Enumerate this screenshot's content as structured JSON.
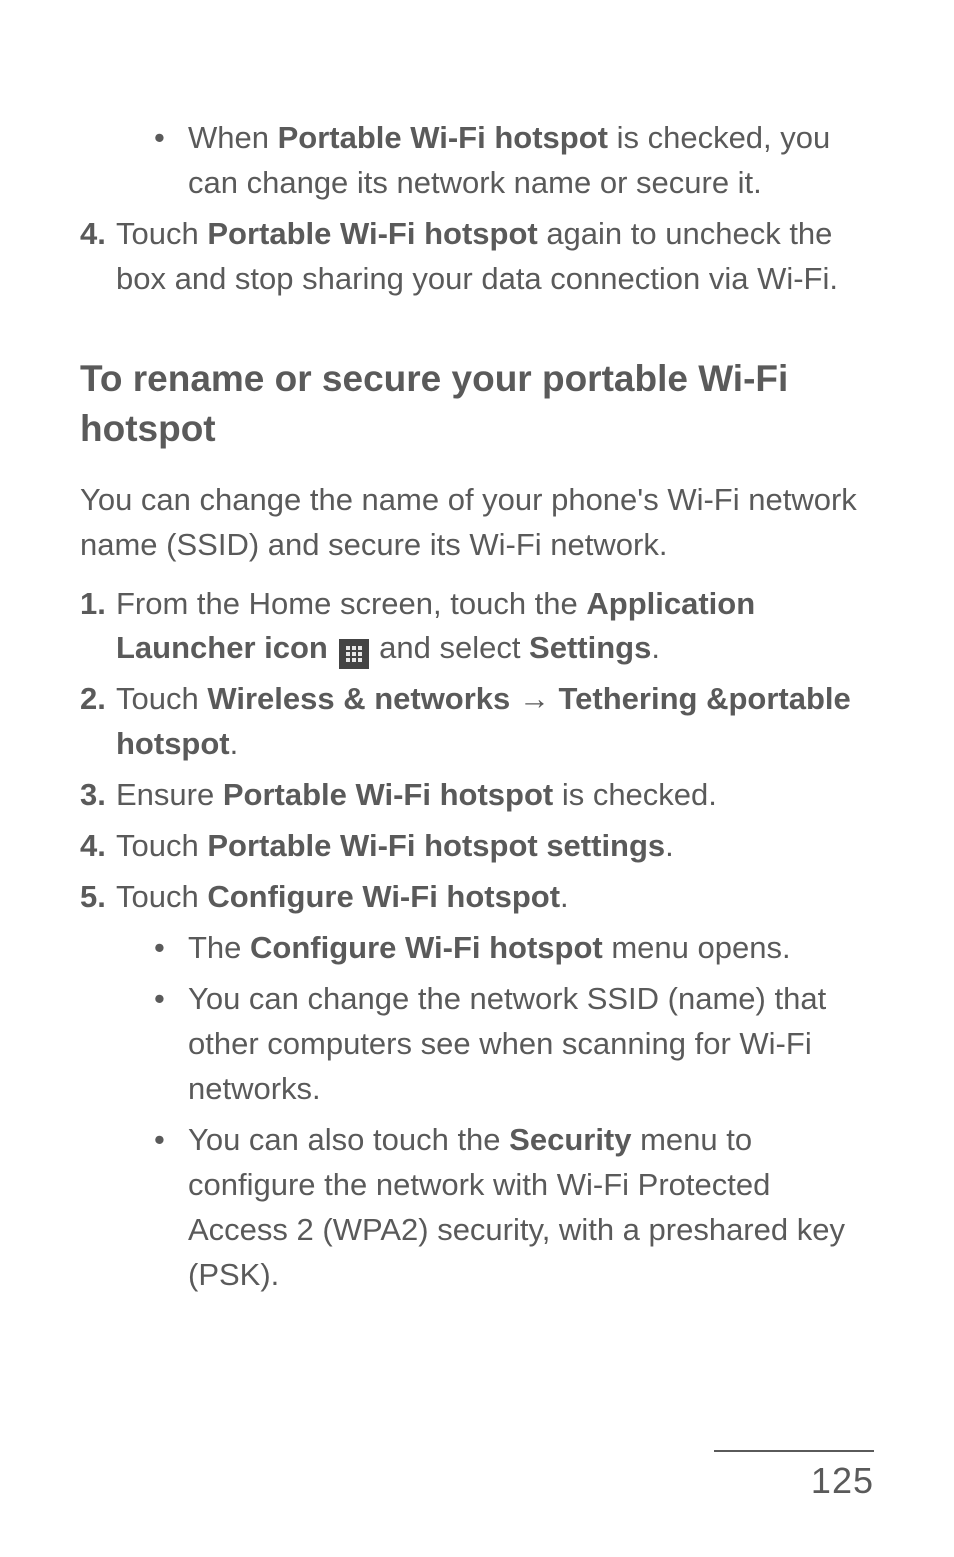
{
  "section1": {
    "bullet1_pre": "When ",
    "bullet1_bold": "Portable Wi-Fi hotspot",
    "bullet1_post": " is checked, you can change its network name or secure it.",
    "step4_num": "4.",
    "step4_pre": "Touch ",
    "step4_bold": "Portable Wi-Fi hotspot",
    "step4_post": " again to uncheck the box and stop sharing your data connection via Wi-Fi."
  },
  "heading2": "To rename or secure your portable Wi-Fi hotspot",
  "intro2": "You can change the name of your phone's Wi-Fi network name (SSID) and secure its Wi-Fi network.",
  "steps2": {
    "s1_num": "1.",
    "s1_pre": " From the Home screen, touch the ",
    "s1_bold1": "Application Launcher icon",
    "s1_mid": " ",
    "s1_post1": " and select ",
    "s1_bold2": "Settings",
    "s1_end": ".",
    "s2_num": "2.",
    "s2_pre": "Touch ",
    "s2_bold1": "Wireless & networks",
    "s2_arrow": " → ",
    "s2_bold2": "Tethering &portable hotspot",
    "s2_end": ".",
    "s3_num": "3.",
    "s3_pre": "Ensure ",
    "s3_bold": "Portable Wi-Fi hotspot",
    "s3_post": " is checked.",
    "s4_num": "4.",
    "s4_pre": "Touch ",
    "s4_bold": "Portable Wi-Fi hotspot settings",
    "s4_end": ".",
    "s5_num": "5.",
    "s5_pre": "Touch ",
    "s5_bold": "Configure Wi-Fi hotspot",
    "s5_end": ".",
    "s5_b1_pre": "The ",
    "s5_b1_bold": "Configure Wi-Fi hotspot",
    "s5_b1_post": " menu opens.",
    "s5_b2": "You can change the network SSID (name) that other computers see when scanning for Wi-Fi networks.",
    "s5_b3_pre": "You can also touch the ",
    "s5_b3_bold": "Security",
    "s5_b3_post": " menu to configure the network with Wi-Fi Protected Access 2 (WPA2) security, with a preshared key (PSK)."
  },
  "page_number": "125"
}
